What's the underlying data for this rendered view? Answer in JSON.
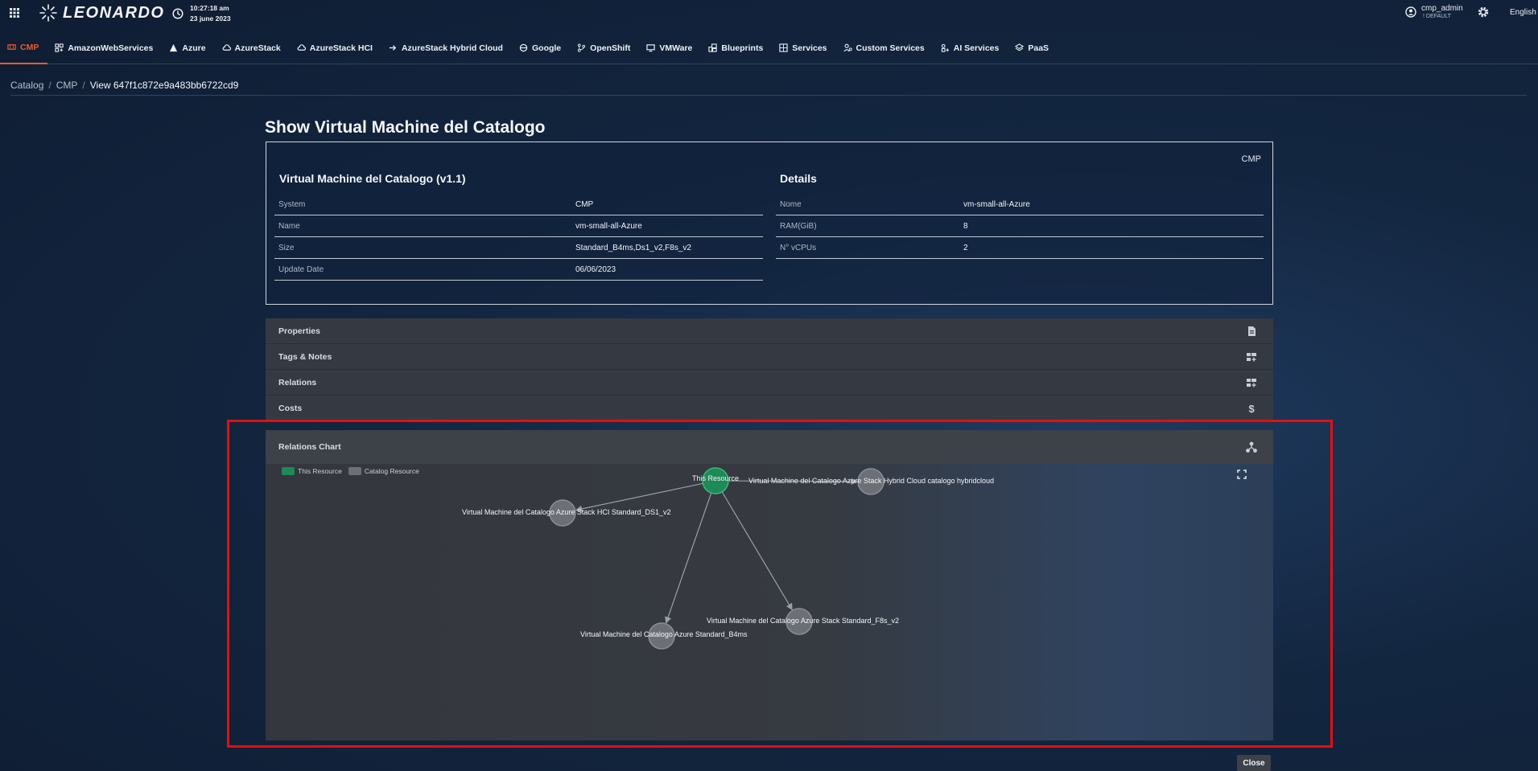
{
  "header": {
    "logo_text": "LEONARDO",
    "time": "10:27:18 am",
    "date": "23 june 2023",
    "user_name": "cmp_admin",
    "user_role": "DEFAULT",
    "language": "English"
  },
  "nav": {
    "items": [
      {
        "label": "CMP",
        "icon": "cmp-icon",
        "active": true
      },
      {
        "label": "AmazonWebServices",
        "icon": "aws-icon"
      },
      {
        "label": "Azure",
        "icon": "azure-icon"
      },
      {
        "label": "AzureStack",
        "icon": "cloud-icon"
      },
      {
        "label": "AzureStack HCI",
        "icon": "cloud-icon"
      },
      {
        "label": "AzureStack Hybrid Cloud",
        "icon": "hybrid-icon"
      },
      {
        "label": "Google",
        "icon": "google-icon"
      },
      {
        "label": "OpenShift",
        "icon": "branch-icon"
      },
      {
        "label": "VMWare",
        "icon": "monitor-icon"
      },
      {
        "label": "Blueprints",
        "icon": "blueprint-icon"
      },
      {
        "label": "Services",
        "icon": "services-icon"
      },
      {
        "label": "Custom Services",
        "icon": "custom-services-icon"
      },
      {
        "label": "AI Services",
        "icon": "ai-icon"
      },
      {
        "label": "PaaS",
        "icon": "layers-icon"
      }
    ]
  },
  "breadcrumb": {
    "items": [
      "Catalog",
      "CMP"
    ],
    "current": "View 647f1c872e9a483bb6722cd9"
  },
  "page": {
    "title": "Show Virtual Machine del Catalogo"
  },
  "details_card": {
    "tag": "CMP",
    "left_title": "Virtual Machine del Catalogo (v1.1)",
    "left_rows": [
      {
        "key": "System",
        "value": "CMP"
      },
      {
        "key": "Name",
        "value": "vm-small-all-Azure"
      },
      {
        "key": "Size",
        "value": "Standard_B4ms,Ds1_v2,F8s_v2"
      },
      {
        "key": "Update Date",
        "value": "06/06/2023"
      }
    ],
    "right_title": "Details",
    "right_rows": [
      {
        "key": "Nome",
        "value": "vm-small-all-Azure"
      },
      {
        "key": "RAM(GiB)",
        "value": "8"
      },
      {
        "key": "N° vCPUs",
        "value": "2"
      }
    ]
  },
  "sections": {
    "properties": "Properties",
    "tags_notes": "Tags & Notes",
    "relations": "Relations",
    "costs": "Costs"
  },
  "relations_chart": {
    "title": "Relations Chart",
    "legend_this": "This Resource",
    "legend_catalog": "Catalog Resource",
    "color_this": "#1e8a57",
    "color_catalog": "#6c6f75",
    "nodes": [
      {
        "id": "self",
        "label": "This Resource",
        "kind": "this"
      },
      {
        "id": "hybrid",
        "label": "Virtual Machine del Catalogo Azure Stack Hybrid Cloud catalogo hybridcloud",
        "kind": "catalog"
      },
      {
        "id": "hci",
        "label": "Virtual Machine del Catalogo Azure Stack HCI Standard_DS1_v2",
        "kind": "catalog"
      },
      {
        "id": "f8s",
        "label": "Virtual Machine del Catalogo Azure Stack Standard_F8s_v2",
        "kind": "catalog"
      },
      {
        "id": "b4ms",
        "label": "Virtual Machine del Catalogo Azure Standard_B4ms",
        "kind": "catalog"
      }
    ],
    "edges": [
      [
        "self",
        "hybrid"
      ],
      [
        "self",
        "hci"
      ],
      [
        "self",
        "f8s"
      ],
      [
        "self",
        "b4ms"
      ]
    ]
  },
  "footer": {
    "close_label": "Close"
  },
  "colors": {
    "accent": "#ee5a2a",
    "highlight_border": "#e11010"
  }
}
